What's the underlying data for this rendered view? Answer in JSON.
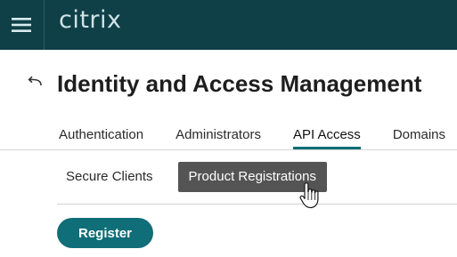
{
  "header": {
    "brand": "citrix",
    "menu_icon": "hamburger-menu-icon"
  },
  "page": {
    "back_icon": "back-arrow-icon",
    "title": "Identity and Access Management"
  },
  "tabs": [
    {
      "label": "Authentication",
      "active": false
    },
    {
      "label": "Administrators",
      "active": false
    },
    {
      "label": "API Access",
      "active": true
    },
    {
      "label": "Domains",
      "active": false
    }
  ],
  "subtabs": [
    {
      "label": "Secure Clients",
      "active": false
    },
    {
      "label": "Product Registrations",
      "active": true
    }
  ],
  "actions": {
    "register_label": "Register"
  },
  "colors": {
    "topbar": "#0f3f47",
    "accent": "#0f6e77",
    "active_subtab": "#545454"
  }
}
